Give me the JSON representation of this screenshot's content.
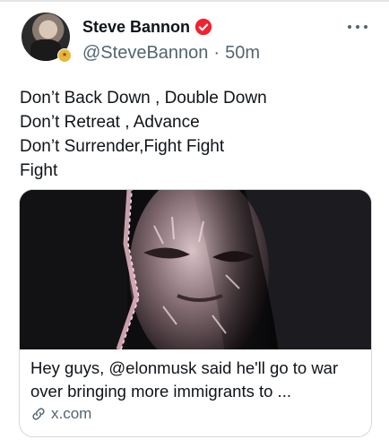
{
  "post": {
    "author_name": "Steve Bannon",
    "handle": "@SteveBannon",
    "separator": "·",
    "timestamp": "50m",
    "text_lines": [
      "Don’t Back Down , Double Down",
      "Don’t Retreat , Advance",
      "Don’t Surrender,Fight Fight",
      "Fight"
    ]
  },
  "card": {
    "title": "Hey guys, @elonmusk said he'll go to war over bringing more immigrants to ...",
    "domain": "x.com"
  },
  "icons": {
    "verified": "verified-badge-icon",
    "more": "more-options-icon",
    "link": "link-icon",
    "affiliate": "affiliate-badge-icon"
  },
  "colors": {
    "verified": "#f4212e",
    "secondary_text": "#536471",
    "primary_text": "#0f1419",
    "card_border": "#cfd9de"
  }
}
